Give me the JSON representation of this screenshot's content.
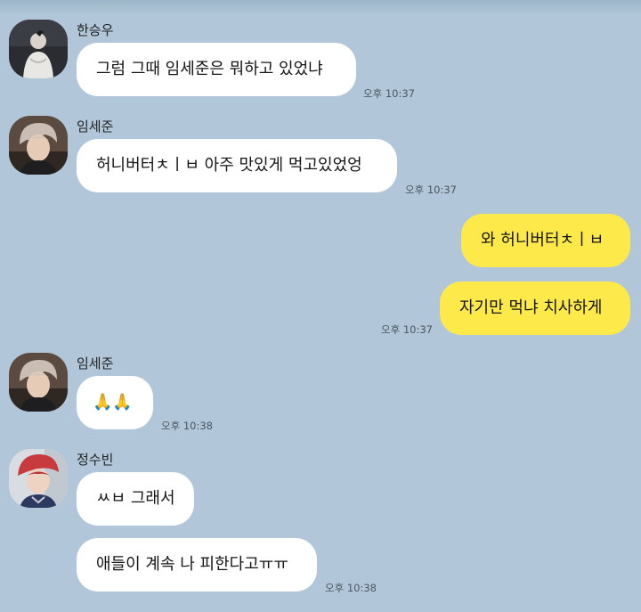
{
  "messages": [
    {
      "sender": "한승우",
      "text": "그럼 그때 임세준은 뭐하고 있었냐",
      "time": "오후 10:37"
    },
    {
      "sender": "임세준",
      "text": "허니버터ㅊㅣㅂ 아주 맛있게 먹고있었엉",
      "time": "오후 10:37"
    },
    {
      "sender": "me",
      "text": "와 허니버터ㅊㅣㅂ",
      "time": ""
    },
    {
      "sender": "me",
      "text": "자기만 먹냐 치사하게",
      "time": "오후 10:37"
    },
    {
      "sender": "임세준",
      "text": "🙏🙏",
      "time": "오후 10:38"
    },
    {
      "sender": "정수빈",
      "text": "ㅆㅂ 그래서",
      "time": ""
    },
    {
      "sender": "정수빈",
      "text": "애들이 계속 나 피한다고ㅠㅠ",
      "time": "오후 10:38"
    }
  ],
  "colors": {
    "background": "#b1c7d9",
    "incoming_bubble": "#ffffff",
    "outgoing_bubble": "#fee94a"
  }
}
